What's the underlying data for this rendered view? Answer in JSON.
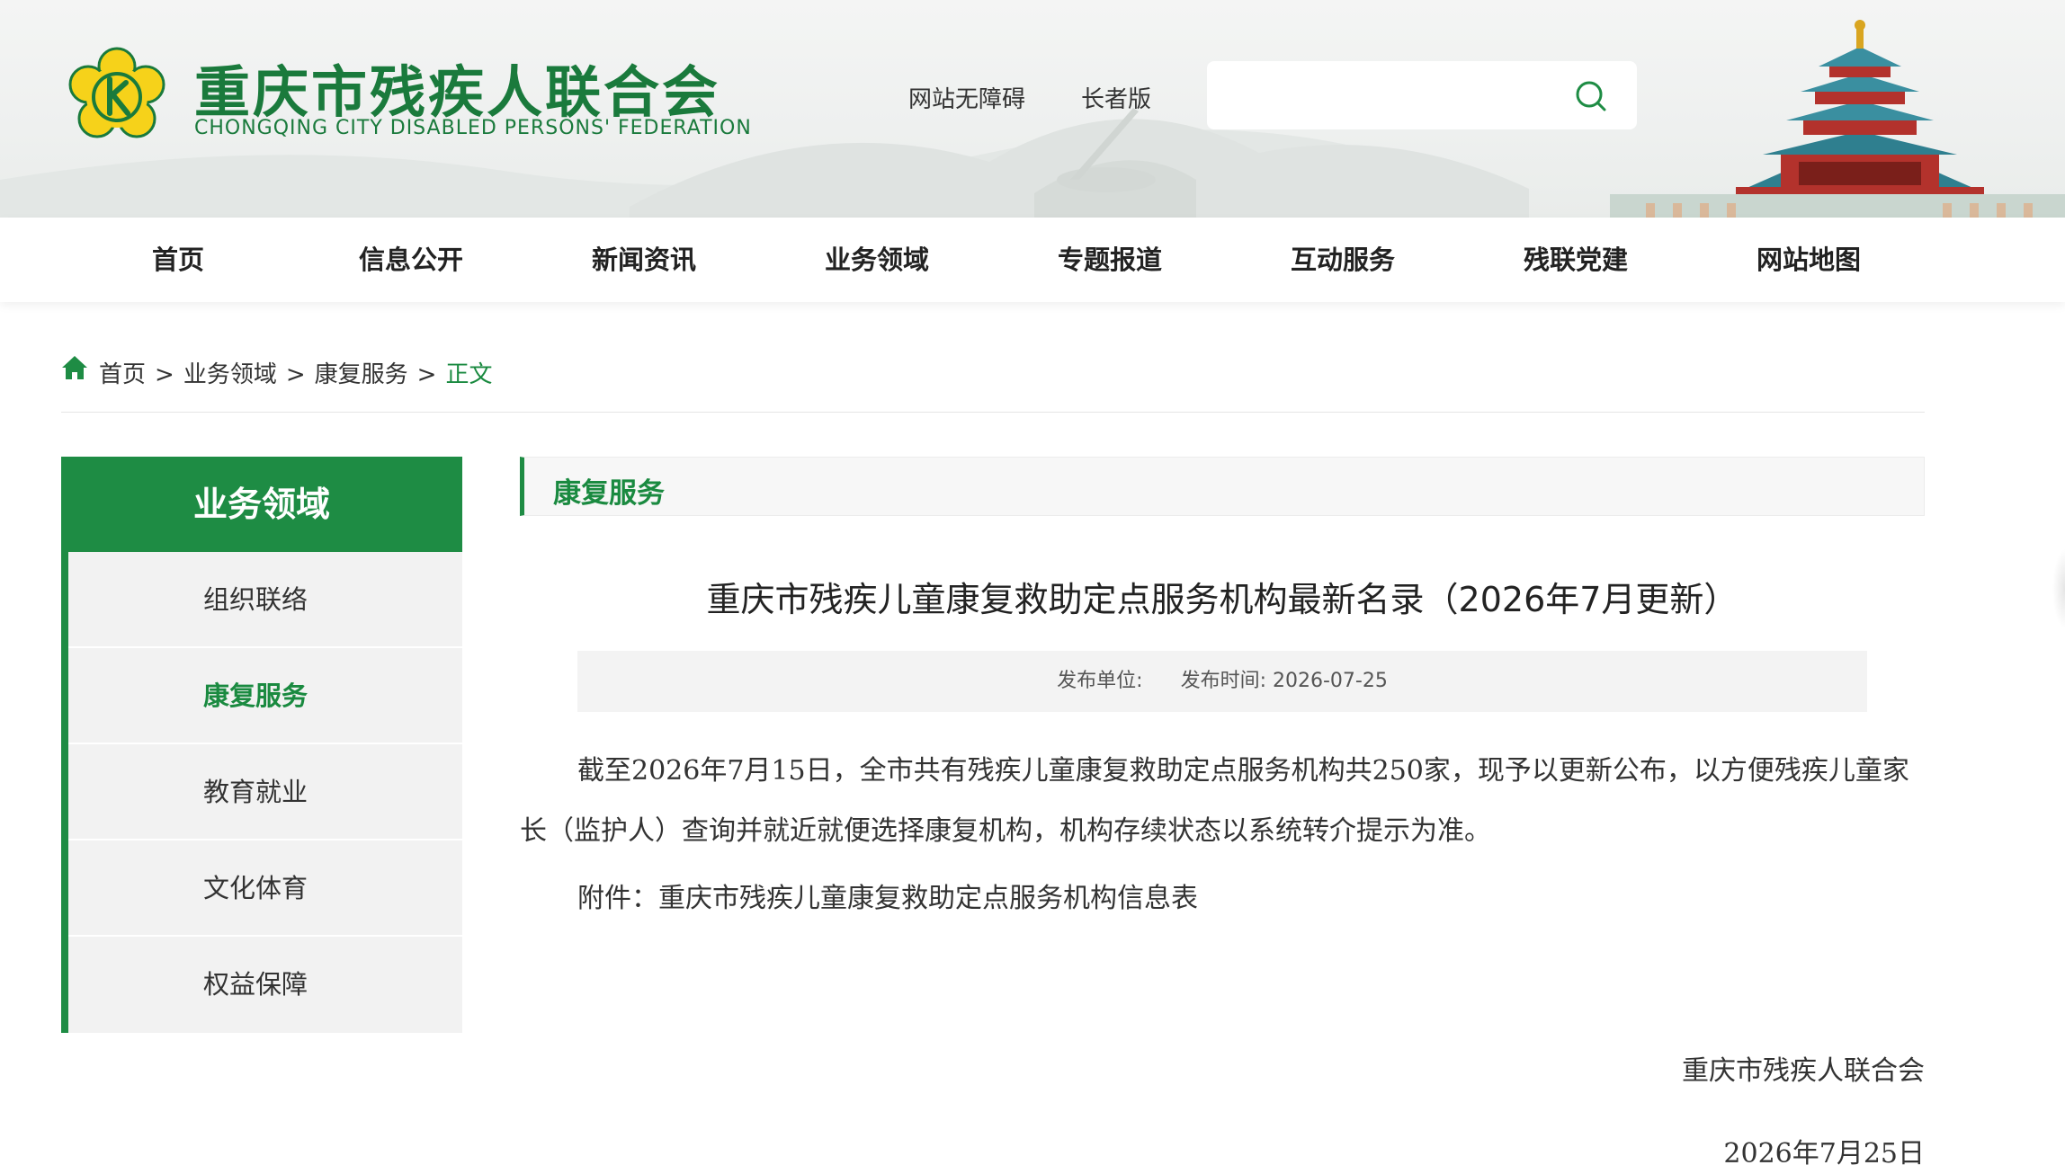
{
  "header": {
    "title": "重庆市残疾人联合会",
    "subtitle": "CHONGQING CITY DISABLED PERSONS' FEDERATION",
    "accessibility_link": "网站无障碍",
    "elder_link": "长者版",
    "search_placeholder": "",
    "search_icon": "search-icon",
    "logo_icon": "federation-emblem",
    "brand_color": "#1e8c44"
  },
  "nav": {
    "items": [
      {
        "label": "首页"
      },
      {
        "label": "信息公开"
      },
      {
        "label": "新闻资讯"
      },
      {
        "label": "业务领域"
      },
      {
        "label": "专题报道"
      },
      {
        "label": "互动服务"
      },
      {
        "label": "残联党建"
      },
      {
        "label": "网站地图"
      }
    ]
  },
  "breadcrumb": {
    "home_icon": "home-icon",
    "items": [
      "首页",
      "业务领域",
      "康复服务"
    ],
    "current": "正文"
  },
  "sidebar": {
    "title": "业务领域",
    "items": [
      {
        "label": "组织联络",
        "active": false
      },
      {
        "label": "康复服务",
        "active": true
      },
      {
        "label": "教育就业",
        "active": false
      },
      {
        "label": "文化体育",
        "active": false
      },
      {
        "label": "权益保障",
        "active": false
      }
    ]
  },
  "section": {
    "label": "康复服务"
  },
  "article": {
    "title": "重庆市残疾儿童康复救助定点服务机构最新名录（2026年7月更新）",
    "meta_unit_label": "发布单位:",
    "meta_time_label": "发布时间:",
    "meta_time_value": "2026-07-25",
    "paragraph": "截至2026年7月15日，全市共有残疾儿童康复救助定点服务机构共250家，现予以更新公布，以方便残疾儿童家长（监护人）查询并就近就便选择康复机构，机构存续状态以系统转介提示为准。",
    "attachment_label": "附件：",
    "attachment_link": "重庆市残疾儿童康复救助定点服务机构信息表",
    "signoff_org": "重庆市残疾人联合会",
    "signoff_date": "2026年7月25日"
  }
}
